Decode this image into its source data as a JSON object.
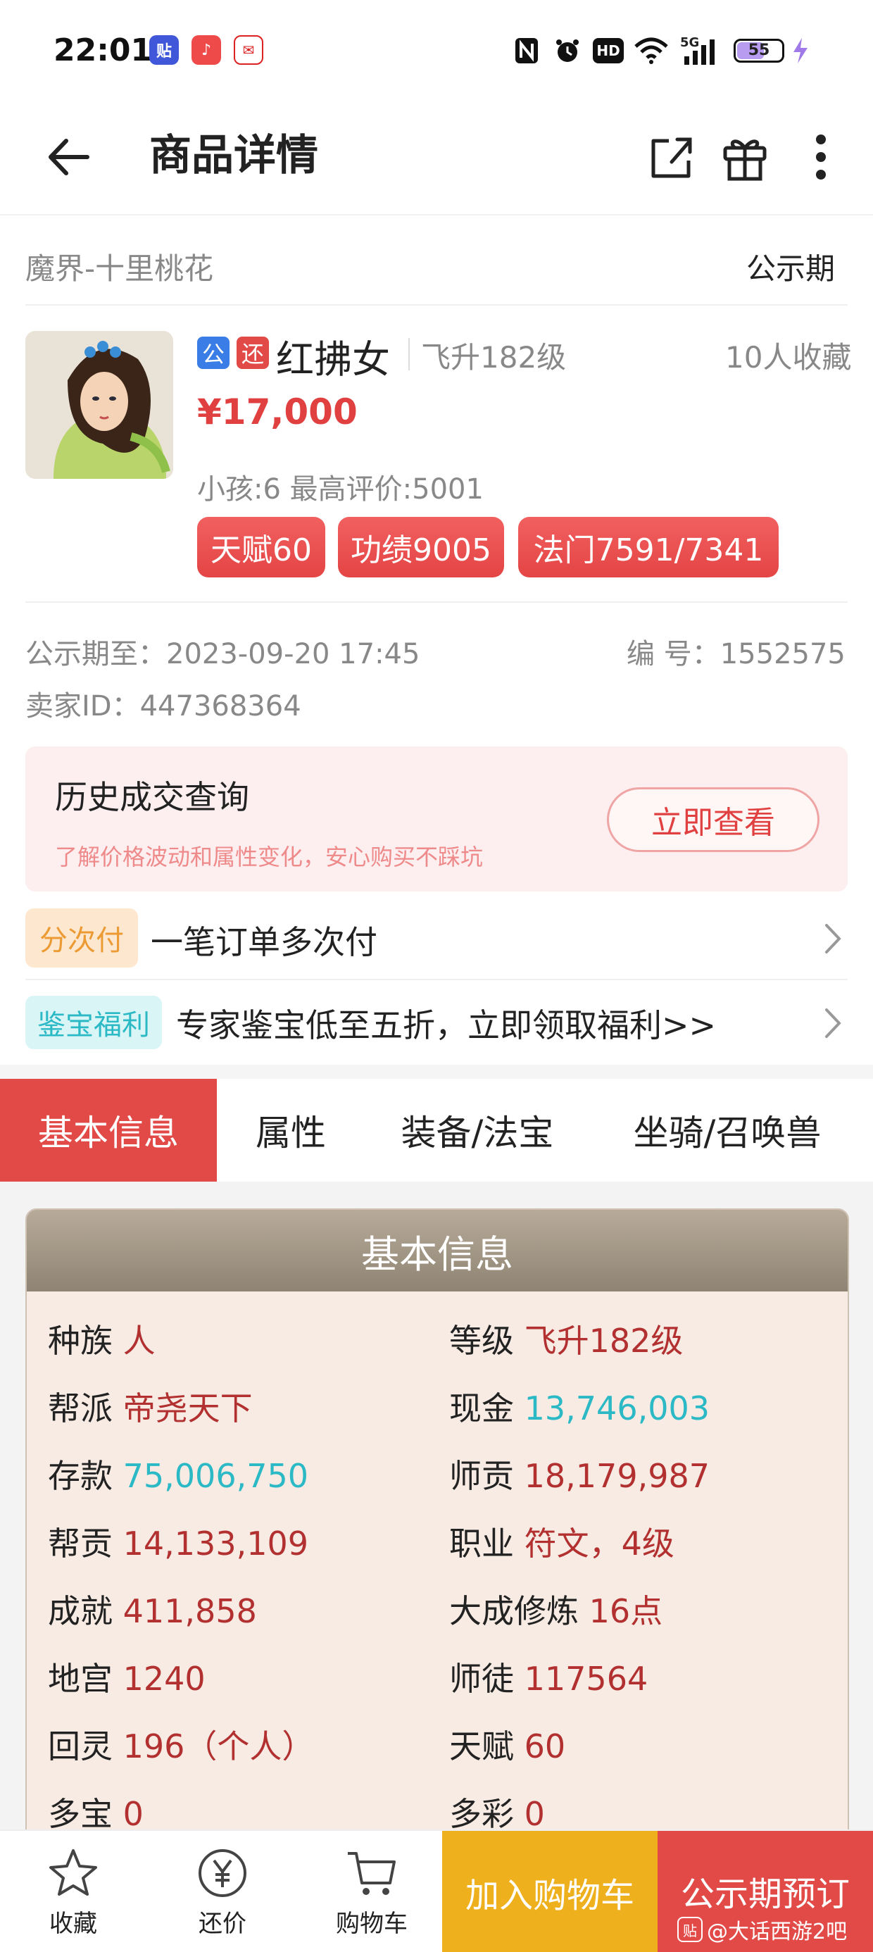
{
  "status_bar": {
    "time": "22:01",
    "notif_icons": [
      "tieba-icon",
      "music-icon",
      "mail-icon"
    ],
    "network": "5G",
    "hd": "HD",
    "battery": "55"
  },
  "header": {
    "title": "商品详情",
    "icons": [
      "back-arrow-icon",
      "share-icon",
      "gift-icon",
      "more-icon"
    ]
  },
  "server": {
    "name": "魔界-十里桃花",
    "status": "公示期"
  },
  "product": {
    "badge_public": "公",
    "badge_bargain": "还",
    "name": "红拂女",
    "level": "飞升182级",
    "favorites": "10人收藏",
    "price": "¥17,000",
    "meta": "小孩:6 最高评价:5001",
    "tags": [
      "天赋60",
      "功绩9005",
      "法门7591/7341"
    ]
  },
  "details": {
    "public_until_label": "公示期至：",
    "public_until": "2023-09-20 17:45",
    "serial_label": "编 号：",
    "serial": "1552575",
    "seller_label": "卖家ID：",
    "seller": "447368364"
  },
  "history": {
    "title": "历史成交查询",
    "subtitle": "了解价格波动和属性变化，安心购买不踩坑",
    "button": "立即查看"
  },
  "promos": [
    {
      "badge": "分次付",
      "text": "一笔订单多次付"
    },
    {
      "badge": "鉴宝福利",
      "text": "专家鉴宝低至五折，立即领取福利>>"
    }
  ],
  "tabs": [
    "基本信息",
    "属性",
    "装备/法宝",
    "坐骑/召唤兽"
  ],
  "basic_info": {
    "title": "基本信息",
    "rows": [
      [
        {
          "label": "种族",
          "value": "人"
        },
        {
          "label": "等级",
          "value": "飞升182级"
        }
      ],
      [
        {
          "label": "帮派",
          "value": "帝尧天下"
        },
        {
          "label": "现金",
          "value": "13,746,003"
        }
      ],
      [
        {
          "label": "存款",
          "value": "75,006,750"
        },
        {
          "label": "师贡",
          "value": "18,179,987"
        }
      ],
      [
        {
          "label": "帮贡",
          "value": "14,133,109"
        },
        {
          "label": "职业",
          "value": "符文，4级"
        }
      ],
      [
        {
          "label": "成就",
          "value": "411,858"
        },
        {
          "label": "大成修炼",
          "value": "16点"
        }
      ],
      [
        {
          "label": "地宫",
          "value": "1240"
        },
        {
          "label": "师徒",
          "value": "117564"
        }
      ],
      [
        {
          "label": "回灵",
          "value": "196（个人）"
        },
        {
          "label": "天赋",
          "value": "60"
        }
      ],
      [
        {
          "label": "多宝",
          "value": "0"
        },
        {
          "label": "多彩",
          "value": "0"
        }
      ]
    ]
  },
  "bottom_bar": {
    "favorite": "收藏",
    "bargain": "还价",
    "cart": "购物车",
    "add_cart": "加入购物车",
    "preorder": "公示期预订",
    "watermark": "@大话西游2吧"
  },
  "colors": {
    "accent_red": "#e24a48",
    "price_red": "#e04040",
    "teal": "#2bb9c5",
    "orange": "#efb01e"
  }
}
